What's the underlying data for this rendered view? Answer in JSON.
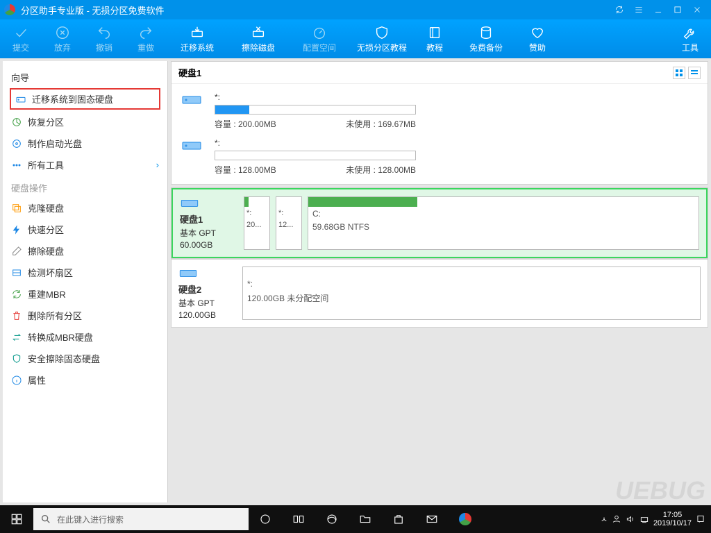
{
  "window": {
    "title": "分区助手专业版 - 无损分区免费软件"
  },
  "toolbar": [
    {
      "id": "commit",
      "label": "提交",
      "enabled": false,
      "icon": "check"
    },
    {
      "id": "discard",
      "label": "放弃",
      "enabled": false,
      "icon": "x-circle"
    },
    {
      "id": "undo",
      "label": "撤销",
      "enabled": false,
      "icon": "undo"
    },
    {
      "id": "redo",
      "label": "重做",
      "enabled": false,
      "icon": "redo"
    },
    {
      "id": "migrate",
      "label": "迁移系统",
      "enabled": true,
      "icon": "drive-arrow"
    },
    {
      "id": "wipe",
      "label": "擦除磁盘",
      "enabled": true,
      "icon": "drive-x"
    },
    {
      "id": "allocate",
      "label": "配置空间",
      "enabled": false,
      "icon": "gauge"
    },
    {
      "id": "lossless",
      "label": "无损分区教程",
      "enabled": true,
      "icon": "shield"
    },
    {
      "id": "tutorial",
      "label": "教程",
      "enabled": true,
      "icon": "book"
    },
    {
      "id": "backup",
      "label": "免费备份",
      "enabled": true,
      "icon": "db"
    },
    {
      "id": "donate",
      "label": "赞助",
      "enabled": true,
      "icon": "heart"
    },
    {
      "id": "tools",
      "label": "工具",
      "enabled": true,
      "icon": "wrench"
    }
  ],
  "sidebar": {
    "wizard_header": "向导",
    "wizard": [
      {
        "label": "迁移系统到固态硬盘",
        "icon": "drive",
        "boxed": true,
        "color": "c-blue"
      },
      {
        "label": "恢复分区",
        "icon": "pie",
        "color": "c-green"
      },
      {
        "label": "制作启动光盘",
        "icon": "disc",
        "color": "c-blue"
      },
      {
        "label": "所有工具",
        "icon": "dots",
        "chev": true,
        "color": "c-blue"
      }
    ],
    "ops_header": "硬盘操作",
    "ops": [
      {
        "label": "克隆硬盘",
        "icon": "copy",
        "color": "c-orange"
      },
      {
        "label": "快速分区",
        "icon": "bolt",
        "color": "c-blue"
      },
      {
        "label": "擦除硬盘",
        "icon": "eraser",
        "color": "c-gray"
      },
      {
        "label": "检测坏扇区",
        "icon": "scan",
        "color": "c-blue"
      },
      {
        "label": "重建MBR",
        "icon": "refresh",
        "color": "c-green"
      },
      {
        "label": "删除所有分区",
        "icon": "trash",
        "color": "c-red"
      },
      {
        "label": "转换成MBR硬盘",
        "icon": "swap",
        "color": "c-teal"
      },
      {
        "label": "安全擦除固态硬盘",
        "icon": "shield",
        "color": "c-teal"
      },
      {
        "label": "属性",
        "icon": "info",
        "color": "c-blue"
      }
    ]
  },
  "top_disk": {
    "title": "硬盘1",
    "parts": [
      {
        "name": "*:",
        "capacity_label": "容量 :",
        "capacity": "200.00MB",
        "unused_label": "未使用 :",
        "unused": "169.67MB",
        "used_pct": 17
      },
      {
        "name": "*:",
        "capacity_label": "容量 :",
        "capacity": "128.00MB",
        "unused_label": "未使用 :",
        "unused": "128.00MB",
        "used_pct": 0
      }
    ]
  },
  "disks": [
    {
      "name": "硬盘1",
      "type": "基本 GPT",
      "size": "60.00GB",
      "selected": true,
      "mini": [
        {
          "label": "*:",
          "sub": "20...",
          "pct": 17
        },
        {
          "label": "*:",
          "sub": "12...",
          "pct": 0
        }
      ],
      "big": {
        "label": "C:",
        "sub": "59.68GB NTFS",
        "pct": 28,
        "green": true
      }
    },
    {
      "name": "硬盘2",
      "type": "基本 GPT",
      "size": "120.00GB",
      "selected": false,
      "mini": [],
      "big": {
        "label": "*:",
        "sub": "120.00GB 未分配空间",
        "pct": 0,
        "gray": true
      }
    }
  ],
  "taskbar": {
    "search_placeholder": "在此键入进行搜索",
    "time": "17:05",
    "date": "2019/10/17"
  },
  "watermark": "UEBUG"
}
